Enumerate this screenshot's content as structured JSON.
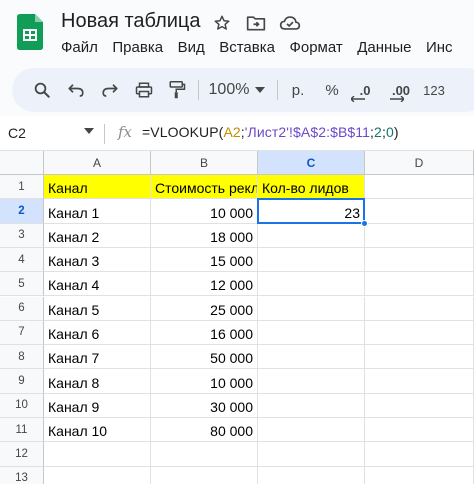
{
  "app": {
    "title": "Новая таблица",
    "colors": {
      "accent": "#1a73e8",
      "sheets_green": "#0f9d58",
      "highlight": "#ffff00"
    }
  },
  "menu": [
    "Файл",
    "Правка",
    "Вид",
    "Вставка",
    "Формат",
    "Данные",
    "Инс"
  ],
  "toolbar": {
    "icons": [
      "search-icon",
      "undo-icon",
      "redo-icon",
      "print-icon",
      "paint-format-icon"
    ],
    "zoom": "100%",
    "currency": "р.",
    "percent": "%",
    "decrease_decimal": ".0",
    "increase_decimal": ".00",
    "number_format": "123"
  },
  "formula_bar": {
    "name_box": "C2",
    "fx": "fx",
    "formula": {
      "prefix": "=VLOOKUP(",
      "ref1": "A2",
      "sep1": ";",
      "ref2": "'Лист2'!$A$2:$B$11",
      "sep2": ";",
      "arg3": "2",
      "sep3": ";",
      "arg4": "0",
      "suffix": ")"
    }
  },
  "sheet": {
    "columns": [
      "A",
      "B",
      "C",
      "D"
    ],
    "active_column": "C",
    "active_row": 2,
    "rows": [
      {
        "n": "1",
        "a": "Канал",
        "b": "Стоимость рекл",
        "c": "Кол-во лидов",
        "d": ""
      },
      {
        "n": "2",
        "a": "Канал 1",
        "b": "10 000",
        "c": "23",
        "d": ""
      },
      {
        "n": "3",
        "a": "Канал 2",
        "b": "18 000",
        "c": "",
        "d": ""
      },
      {
        "n": "4",
        "a": "Канал 3",
        "b": "15 000",
        "c": "",
        "d": ""
      },
      {
        "n": "5",
        "a": "Канал 4",
        "b": "12 000",
        "c": "",
        "d": ""
      },
      {
        "n": "6",
        "a": "Канал 5",
        "b": "25 000",
        "c": "",
        "d": ""
      },
      {
        "n": "7",
        "a": "Канал 6",
        "b": "16 000",
        "c": "",
        "d": ""
      },
      {
        "n": "8",
        "a": "Канал 7",
        "b": "50 000",
        "c": "",
        "d": ""
      },
      {
        "n": "9",
        "a": "Канал 8",
        "b": "10 000",
        "c": "",
        "d": ""
      },
      {
        "n": "10",
        "a": "Канал 9",
        "b": "30 000",
        "c": "",
        "d": ""
      },
      {
        "n": "11",
        "a": "Канал 10",
        "b": "80 000",
        "c": "",
        "d": ""
      },
      {
        "n": "12",
        "a": "",
        "b": "",
        "c": "",
        "d": ""
      },
      {
        "n": "13",
        "a": "",
        "b": "",
        "c": "",
        "d": ""
      }
    ]
  }
}
